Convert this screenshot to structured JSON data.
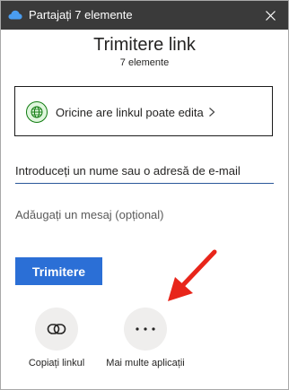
{
  "titlebar": {
    "title": "Partajați 7 elemente",
    "app_icon": "onedrive-cloud-icon",
    "close_icon": "close-icon",
    "background": "#3a3a3a"
  },
  "header": {
    "title": "Trimitere link",
    "subtitle": "7 elemente"
  },
  "link_settings": {
    "label": "Oricine are linkul poate edita",
    "icon": "globe-icon",
    "accent": "#107c10"
  },
  "recipients": {
    "placeholder": "Introduceți un nume sau o adresă de e-mail"
  },
  "message": {
    "placeholder": "Adăugați un mesaj (opțional)"
  },
  "send": {
    "label": "Trimitere",
    "color": "#2b6fd6"
  },
  "share_options": [
    {
      "label": "Copiați linkul",
      "icon": "link-icon"
    },
    {
      "label": "Mai multe aplicații",
      "icon": "more-icon"
    }
  ],
  "annotation": {
    "icon": "red-arrow-icon",
    "color": "#e8251a"
  }
}
